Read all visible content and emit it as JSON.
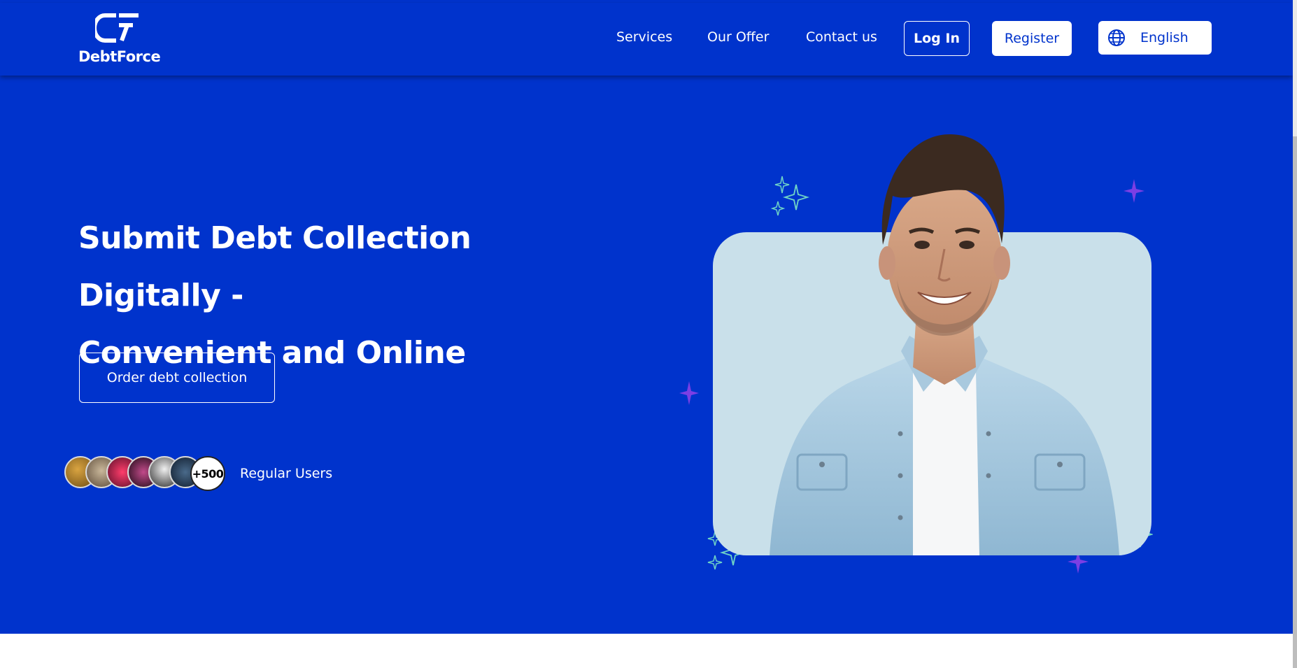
{
  "header": {
    "logo_text": "DebtForce",
    "logo_icon": "debtforce-logo-icon",
    "nav": [
      {
        "label": "Services"
      },
      {
        "label": "Our Offer"
      },
      {
        "label": "Contact us"
      }
    ],
    "login_label": "Log In",
    "register_label": "Register",
    "language": {
      "label": "English",
      "icon": "globe-icon"
    }
  },
  "hero": {
    "title_line1": "Submit Debt Collection Digitally -",
    "title_line2": "Convenient and Online",
    "cta_label": "Order debt collection",
    "users_count": "+500",
    "users_label": "Regular Users"
  },
  "colors": {
    "brand_blue": "#0033cc",
    "white": "#ffffff",
    "card_bg": "#c9e0ea",
    "sparkle_purple": "#7b3fe4",
    "sparkle_teal": "#6fd3c6"
  }
}
